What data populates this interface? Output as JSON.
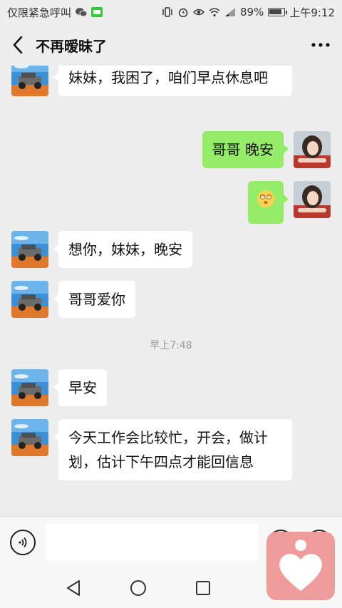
{
  "status_bar": {
    "carrier": "仅限紧急呼叫",
    "battery": "89%",
    "battery_level": 0.89,
    "time": "上午9:12"
  },
  "header": {
    "back_icon": "chevron-left-icon",
    "title": "不再暧昧了",
    "more_icon": "more-dots-icon"
  },
  "messages": [
    {
      "side": "left",
      "text": "妹妹，我困了，咱们早点休息吧"
    },
    {
      "side": "right",
      "text": "哥哥 晚安"
    },
    {
      "side": "right",
      "text": "",
      "emoji": "dizzy-face-emoji"
    },
    {
      "side": "left",
      "text": "想你，妹妹，晚安"
    },
    {
      "side": "left",
      "text": "哥哥爱你"
    },
    {
      "type": "time",
      "text": "早上7:48"
    },
    {
      "side": "left",
      "text": "早安"
    },
    {
      "side": "left",
      "text": "今天工作会比较忙，开会，做计划，估计下午四点才能回信息"
    }
  ],
  "input_bar": {
    "voice_icon": "voice-icon",
    "text_value": "",
    "emoji_icon": "emoji-icon",
    "plus_icon": "plus-icon"
  },
  "nav": {
    "back": "nav-back-icon",
    "home": "nav-home-icon",
    "recents": "nav-recents-icon"
  },
  "overlay": {
    "icon": "heart-app-icon",
    "color": "#f09b9b"
  },
  "colors": {
    "sent_bubble": "#95ec69",
    "received_bubble": "#ffffff",
    "background": "#ededed"
  }
}
